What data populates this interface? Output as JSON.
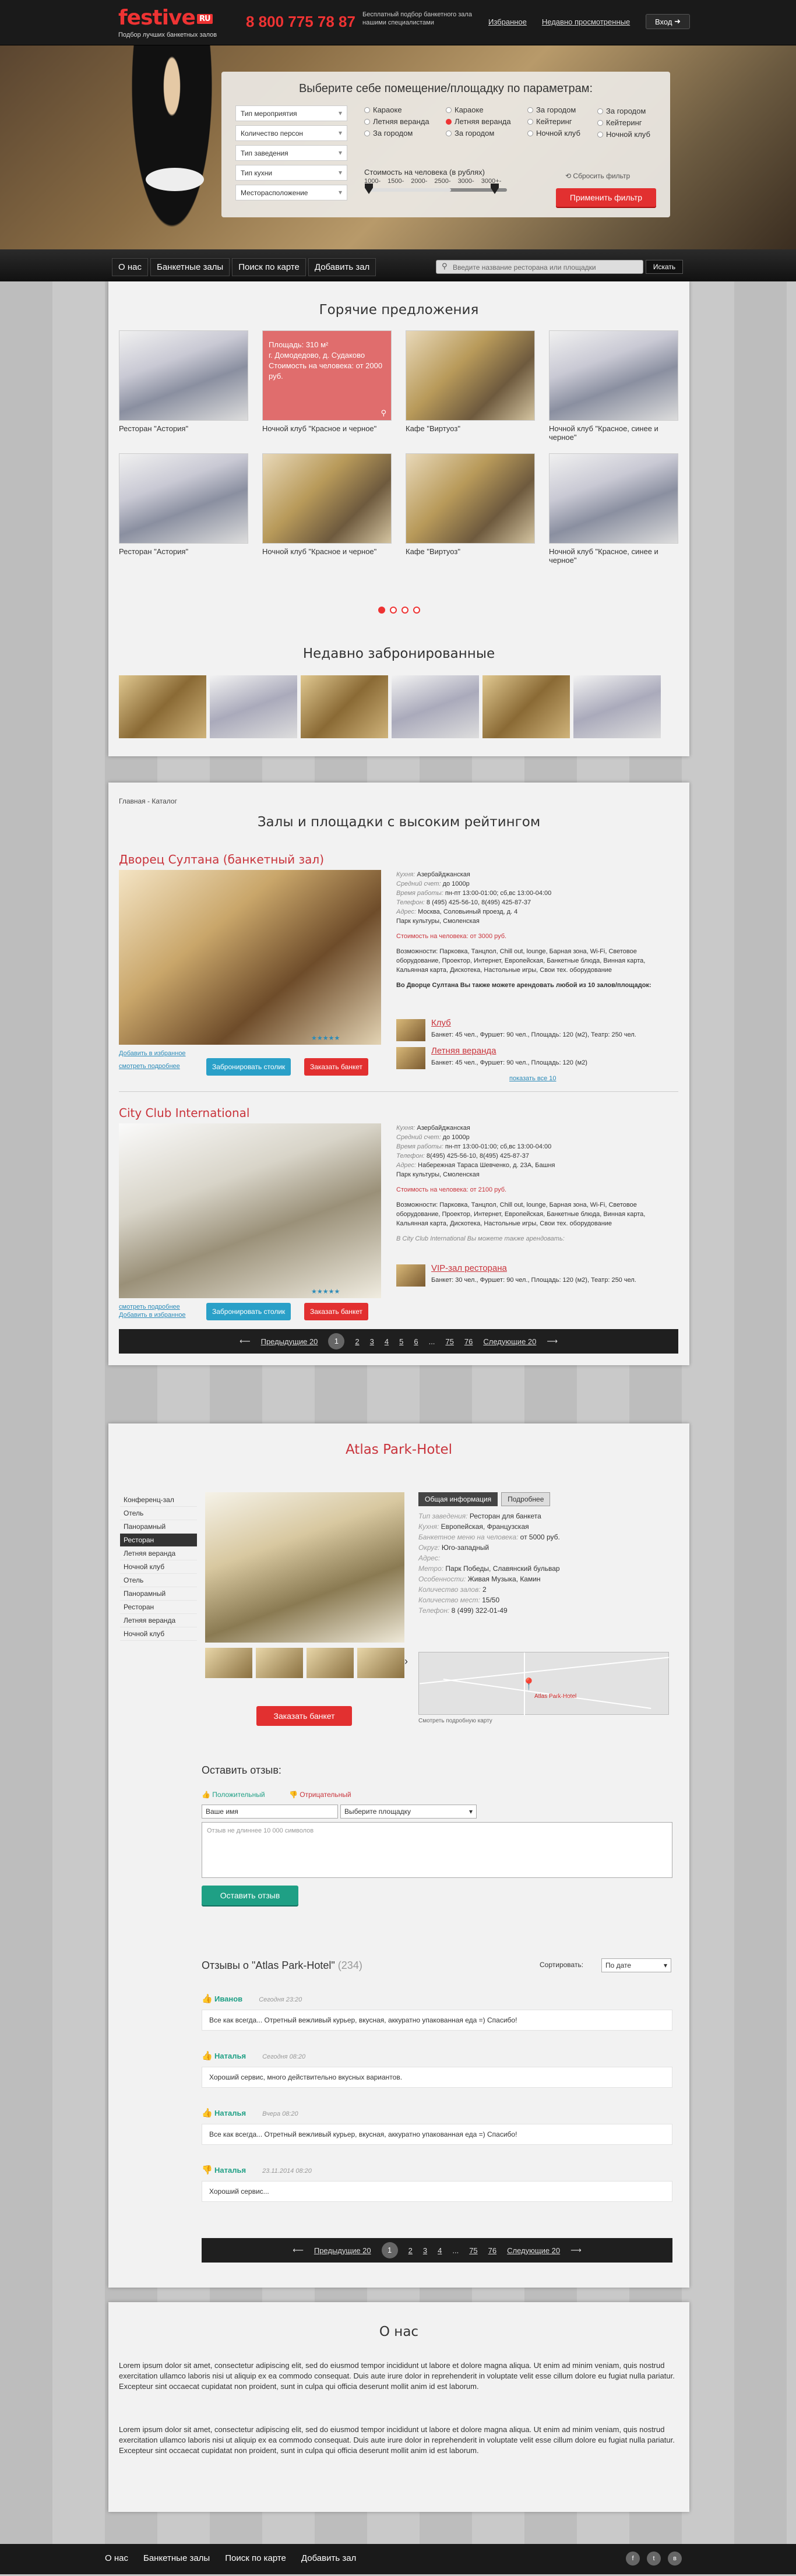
{
  "header": {
    "logo": "festive",
    "logo_badge": "RU",
    "logo_sub": "Подбор лучших банкетных залов",
    "phone": "8 800 775 78 87",
    "tagline": "Бесплатный подбор банкетного зала нашими специалистами",
    "link_favorites": "Избранное",
    "link_recent": "Недавно просмотренные",
    "login": "Вход"
  },
  "filter": {
    "title": "Выберите себе помещение/площадку по параметрам:",
    "selects": [
      "Тип мероприятия",
      "Количество персон",
      "Тип заведения",
      "Тип кухни",
      "Месторасположение"
    ],
    "checks": [
      [
        "Караоке",
        "Летняя веранда",
        "За городом"
      ],
      [
        "Караоке",
        "Летняя веранда",
        "За городом"
      ],
      [
        "За городом",
        "Кейтеринг",
        "Ночной клуб"
      ],
      [
        "За городом",
        "Кейтеринг",
        "Ночной клуб"
      ]
    ],
    "price_label": "Стоимость на человека (в рублях)",
    "ticks": [
      "1000-",
      "1500-",
      "2000-",
      "2500-",
      "3000-",
      "3000+-"
    ],
    "reset": "Сбросить фильтр",
    "apply": "Применить фильтр"
  },
  "nav": {
    "items": [
      "О нас",
      "Банкетные залы",
      "Поиск по карте",
      "Добавить зал"
    ],
    "search_placeholder": "Введите название ресторана или площадки",
    "search_btn": "Искать"
  },
  "hot": {
    "title": "Горячие предложения",
    "cards": [
      "Ресторан \"Астория\"",
      "Ночной клуб \"Красное и черное\"",
      "Кафе \"Виртуоз\"",
      "Ночной клуб \"Красное, синее и черное\"",
      "Ресторан \"Астория\"",
      "Ночной клуб \"Красное и черное\"",
      "Кафе \"Виртуоз\"",
      "Ночной клуб \"Красное, синее и черное\""
    ],
    "red_card": [
      "Площадь: 310 м²",
      "г. Домодедово, д. Судаково",
      "Стоимость на человека: от 2000 руб."
    ]
  },
  "recent": {
    "title": "Недавно забронированные"
  },
  "catalog": {
    "crumb": "Главная - Каталог",
    "title": "Залы и площадки с высоким рейтингом",
    "listings": [
      {
        "name": "Дворец Султана (банкетный зал)",
        "info": [
          [
            "Кухня:",
            "Азербайджанская"
          ],
          [
            "Средний счет:",
            "до 1000р"
          ],
          [
            "Время работы:",
            "пн-пт 13:00-01:00; сб,вс 13:00-04:00"
          ],
          [
            "Телефон:",
            "8 (495) 425-56-10, 8(495) 425-87-37"
          ],
          [
            "Адрес:",
            "Москва, Соловьиный проезд, д. 4"
          ],
          [
            "",
            "Парк культуры, Смоленская"
          ]
        ],
        "price": "Стоимость на человека: от 3000 руб.",
        "features": "Возможности: Парковка, Танцпол, Chill out, lounge, Барная зона, Wi-Fi, Световое оборудование, Проектор, Интернет, Европейская, Банкетные блюда, Винная карта, Кальянная карта, Дискотека, Настольные игры, Свои тех. оборудование",
        "also": "Во Дворце Султана Вы также можете арендовать любой из 10 залов/площадок:",
        "subs": [
          {
            "name": "Клуб",
            "meta": "Банкет: 45 чел., Фуршет: 90 чел., Площадь: 120 (м2), Театр: 250 чел."
          },
          {
            "name": "Летняя веранда",
            "meta": "Банкет: 45 чел., Фуршет: 90 чел., Площадь: 120 (м2)"
          }
        ],
        "show_all": "показать все 10",
        "link1": "Добавить в избранное",
        "link2": "смотреть подробнее",
        "btn_table": "Забронировать столик",
        "btn_banquet": "Заказать банкет"
      },
      {
        "name": "City Club International",
        "info": [
          [
            "Кухня:",
            "Азербайджанская"
          ],
          [
            "Средний счет:",
            "до 1000р"
          ],
          [
            "Время работы:",
            "пн-пт 13:00-01:00; сб,вс 13:00-04:00"
          ],
          [
            "Телефон:",
            "8(495) 425-56-10, 8(495) 425-87-37"
          ],
          [
            "Адрес:",
            "Набережная Тараса Шевченко, д. 23А, Башня"
          ],
          [
            "",
            "Парк культуры, Смоленская"
          ]
        ],
        "price": "Стоимость на человека: от 2100 руб.",
        "features": "Возможности: Парковка, Танцпол, Chill out, lounge, Барная зона, Wi-Fi, Световое оборудование, Проектор, Интернет, Европейская, Банкетные блюда, Винная карта, Кальянная карта, Дискотека, Настольные игры, Свои тех. оборудование",
        "also": "В City Club International Вы можете также арендовать:",
        "subs": [
          {
            "name": "VIP-зал ресторана",
            "meta": "Банкет: 30 чел., Фуршет: 90 чел., Площадь: 120 (м2), Театр: 250 чел."
          }
        ],
        "link1": "смотреть подробнее",
        "link2": "Добавить в избранное",
        "btn_table": "Забронировать столик",
        "btn_banquet": "Заказать банкет"
      }
    ],
    "pager": {
      "prev": "Предыдущие 20",
      "pages": [
        "1",
        "2",
        "3",
        "4",
        "5",
        "6",
        "...",
        "75",
        "76"
      ],
      "next": "Следующие 20"
    }
  },
  "detail": {
    "title": "Atlas Park-Hotel",
    "menu": [
      "Конференц-зал",
      "Отель",
      "Панорамный",
      "Ресторан",
      "Летняя веранда",
      "Ночной клуб",
      "Отель",
      "Панорамный",
      "Ресторан",
      "Летняя веранда",
      "Ночной клуб"
    ],
    "tab_info": "Общая информация",
    "tab_more": "Подробнее",
    "info": [
      [
        "Тип заведения:",
        "Ресторан для банкета"
      ],
      [
        "Кухня:",
        "Европейская, Французская"
      ],
      [
        "Банкетное меню на человека:",
        "от 5000 руб."
      ],
      [
        "Округ:",
        "Юго-западный"
      ],
      [
        "Адрес:",
        ""
      ],
      [
        "Метро:",
        "Парк Победы, Славянский бульвар"
      ],
      [
        "Особенности:",
        "Живая Музыка, Камин"
      ],
      [
        "Количество залов:",
        "2"
      ],
      [
        "Количество мест:",
        "15/50"
      ],
      [
        "Телефон:",
        "8 (499) 322-01-49"
      ]
    ],
    "map_note": "Смотреть подробную карту",
    "map_label": "Atlas Park-Hotel",
    "order_btn": "Заказать банкет"
  },
  "review_form": {
    "title": "Оставить отзыв:",
    "positive": "Положительный",
    "negative": "Отрицательный",
    "name_ph": "Ваше имя",
    "venue_ph": "Выберите площадку",
    "text_ph": "Отзыв не длиннее 10 000 символов",
    "submit": "Оставить отзыв"
  },
  "reviews": {
    "title": "Отзывы о \"Atlas Park-Hotel\"",
    "count": "(234)",
    "sort_label": "Сортировать:",
    "sort_value": "По дате",
    "items": [
      {
        "author": "Иванов",
        "date": "Сегодня 23:20",
        "text": "Все как всегда... Отретный вежливый курьер, вкусная, аккуратно упакованная еда =) Спасибо!",
        "positive": true
      },
      {
        "author": "Наталья",
        "date": "Сегодня 08:20",
        "text": "Хороший сервис, много действительно вкусных вариантов.",
        "positive": true
      },
      {
        "author": "Наталья",
        "date": "Вчера 08:20",
        "text": "Все как всегда... Отретный вежливый курьер, вкусная, аккуратно упакованная еда =) Спасибо!",
        "positive": true
      },
      {
        "author": "Наталья",
        "date": "23.11.2014 08:20",
        "text": "Хороший сервис...",
        "positive": false
      }
    ],
    "pager": {
      "prev": "Предыдущие 20",
      "pages": [
        "1",
        "2",
        "3",
        "4",
        "...",
        "75",
        "76"
      ],
      "next": "Следующие 20"
    }
  },
  "about": {
    "title": "О нас",
    "p1": "Lorem ipsum dolor sit amet, consectetur adipiscing elit, sed do eiusmod tempor incididunt ut labore et dolore magna aliqua. Ut enim ad minim veniam, quis nostrud exercitation ullamco laboris nisi ut aliquip ex ea commodo consequat. Duis aute irure dolor in reprehenderit in voluptate velit esse cillum dolore eu fugiat nulla pariatur. Excepteur sint occaecat cupidatat non proident, sunt in culpa qui officia deserunt mollit anim id est laborum.",
    "p2": "Lorem ipsum dolor sit amet, consectetur adipiscing elit, sed do eiusmod tempor incididunt ut labore et dolore magna aliqua. Ut enim ad minim veniam, quis nostrud exercitation ullamco laboris nisi ut aliquip ex ea commodo consequat. Duis aute irure dolor in reprehenderit in voluptate velit esse cillum dolore eu fugiat nulla pariatur. Excepteur sint occaecat cupidatat non proident, sunt in culpa qui officia deserunt mollit anim id est laborum."
  },
  "footer": {
    "items": [
      "О нас",
      "Банкетные залы",
      "Поиск по карте",
      "Добавить зал"
    ],
    "social": [
      "f",
      "t",
      "в"
    ]
  },
  "colors": {
    "accent": "#e23030",
    "blue": "#2aa0c8",
    "green": "#1fa085"
  }
}
